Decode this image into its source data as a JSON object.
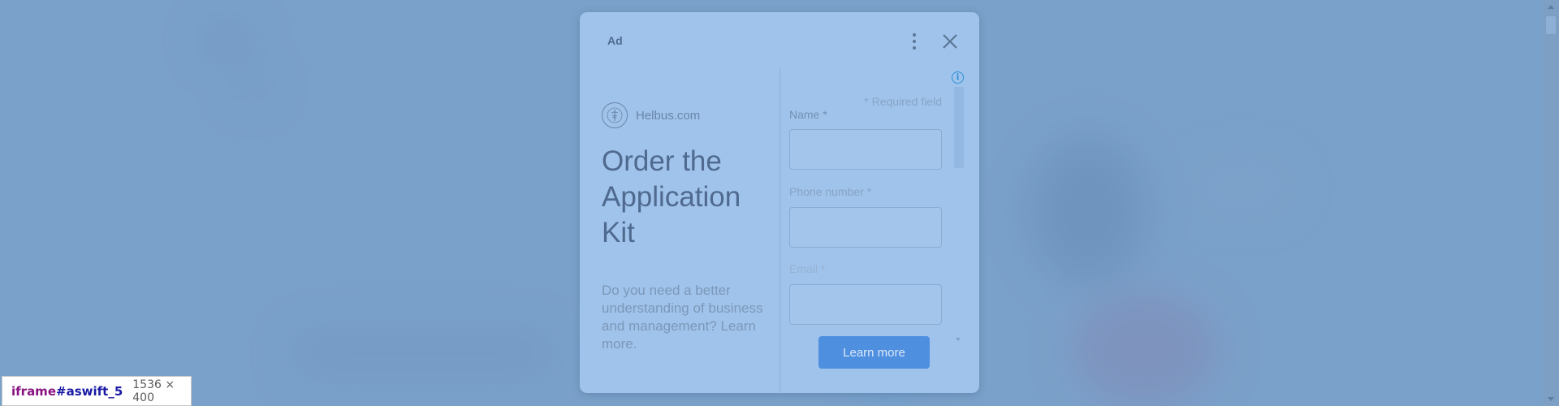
{
  "ad": {
    "label": "Ad",
    "brand_name": "Helbus.com",
    "headline": "Order the Application Kit",
    "description": "Do you need a better understanding of business and management? Learn more.",
    "required_note": "* Required field",
    "fields": [
      {
        "label": "Name *",
        "value": "",
        "label_color": "#7390b3"
      },
      {
        "label": "Phone number *",
        "value": "",
        "label_color": "#86a3c5"
      },
      {
        "label": "Email *",
        "value": "",
        "label_color": "#96b3d3"
      }
    ],
    "cta_label": "Learn more",
    "icons": {
      "more": "more-vertical-icon",
      "close": "close-icon",
      "info": "info-icon",
      "logo": "caduceus-seal-icon"
    }
  },
  "devtools_tooltip": {
    "tag": "iframe",
    "id": "#aswift_5",
    "size": "1536 × 400"
  },
  "colors": {
    "overlay": "#7aa2cc",
    "dialog_bg": "#a0c3eb",
    "cta_bg": "#4f8fe0",
    "info_blue": "#2b8fd6"
  }
}
